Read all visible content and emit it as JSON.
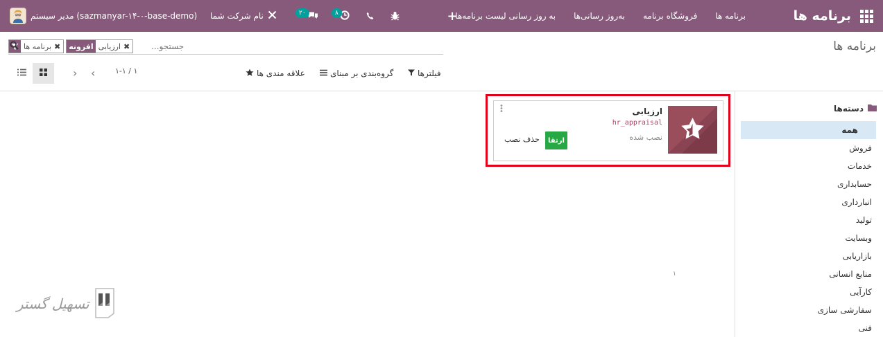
{
  "topbar": {
    "brand": "برنامه ها",
    "menu": [
      "برنامه ها",
      "فروشگاه برنامه",
      "به‌روز رسانی‌ها",
      "به روز رسانی لیست برنامه‌ها"
    ],
    "activity_count": "۸",
    "messages_count": "۲۰",
    "company": "نام شرکت شما",
    "user": "مدیر سیستم (sazmanyar-۱۴-۰-base-demo)"
  },
  "breadcrumb": "برنامه ها",
  "search": {
    "facets": [
      {
        "label": "",
        "value": "برنامه ها",
        "filter_icon": true
      },
      {
        "label": "افزونه",
        "value": "ارزیابی"
      }
    ],
    "placeholder": "جستجو..."
  },
  "controls": {
    "filters": "فیلترها",
    "groupby": "گروه‌بندی بر مبنای",
    "favorites": "علاقه مندی ها",
    "pager": "۱-۱ / ۱"
  },
  "sidebar": {
    "header": "دسته‌ها",
    "items": [
      {
        "label": "همه",
        "active": true
      },
      {
        "label": "فروش"
      },
      {
        "label": "خدمات"
      },
      {
        "label": "حسابداری"
      },
      {
        "label": "انبارداری"
      },
      {
        "label": "تولید"
      },
      {
        "label": "وبسایت"
      },
      {
        "label": "بازاریابی"
      },
      {
        "label": "منابع انسانی",
        "count": "۱"
      },
      {
        "label": "کارآیی"
      },
      {
        "label": "سفارشی سازی"
      },
      {
        "label": "فنی"
      }
    ]
  },
  "card": {
    "title": "ارزیابی",
    "technical_name": "hr_appraisal",
    "status": "نصب شده",
    "upgrade": "ارتقا",
    "uninstall": "حذف نصب"
  },
  "watermark": "تسهیل گستر",
  "colors": {
    "brand": "#875a7b",
    "upgrade": "#28a745",
    "highlight": "#e3001b",
    "active_item": "#d8e9f5"
  }
}
